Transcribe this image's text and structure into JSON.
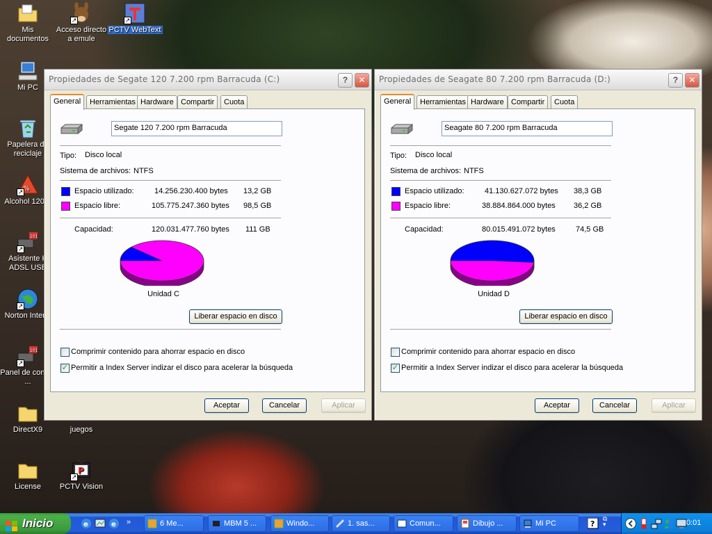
{
  "desktop": {
    "icons": [
      {
        "label": "Mis documentos"
      },
      {
        "label": "Acceso directo a emule"
      },
      {
        "label": "PCTV WebText"
      },
      {
        "label": "Mi PC"
      },
      {
        "label": "Papelera de reciclaje"
      },
      {
        "label": "Alcohol 120%"
      },
      {
        "label": "Asistente K ADSL USB"
      },
      {
        "label": "Norton Inter..."
      },
      {
        "label": "Panel de control ..."
      },
      {
        "label": "DirectX9"
      },
      {
        "label": "juegos"
      },
      {
        "label": "License"
      },
      {
        "label": "PCTV Vision"
      }
    ]
  },
  "dialogs": [
    {
      "title": "Propiedades de Segate 120 7.200 rpm Barracuda (C:)",
      "tabs": [
        "General",
        "Herramientas",
        "Hardware",
        "Compartir",
        "Cuota"
      ],
      "name": "Segate 120 7.200 rpm Barracuda",
      "tipo_label": "Tipo:",
      "tipo": "Disco local",
      "fs_label": "Sistema de archivos:",
      "fs": "NTFS",
      "used_label": "Espacio utilizado:",
      "used_bytes": "14.256.230.400 bytes",
      "used_gb": "13,2 GB",
      "free_label": "Espacio libre:",
      "free_bytes": "105.775.247.360 bytes",
      "free_gb": "98,5 GB",
      "cap_label": "Capacidad:",
      "cap_bytes": "120.031.477.760 bytes",
      "cap_gb": "111 GB",
      "used_fraction": 0.119,
      "drive_label": "Unidad C",
      "cleanup": "Liberar espacio en disco",
      "compress": "Comprimir contenido para ahorrar espacio en disco",
      "compress_checked": false,
      "index": "Permitir a Index Server indizar el disco para acelerar la búsqueda",
      "index_checked": true,
      "ok": "Aceptar",
      "cancel": "Cancelar",
      "apply": "Aplicar"
    },
    {
      "title": "Propiedades de Seagate 80 7.200 rpm Barracuda (D:)",
      "tabs": [
        "General",
        "Herramientas",
        "Hardware",
        "Compartir",
        "Cuota"
      ],
      "name": "Seagate 80 7.200 rpm Barracuda",
      "tipo_label": "Tipo:",
      "tipo": "Disco local",
      "fs_label": "Sistema de archivos:",
      "fs": "NTFS",
      "used_label": "Espacio utilizado:",
      "used_bytes": "41.130.627.072 bytes",
      "used_gb": "38,3 GB",
      "free_label": "Espacio libre:",
      "free_bytes": "38.884.864.000 bytes",
      "free_gb": "36,2 GB",
      "cap_label": "Capacidad:",
      "cap_bytes": "80.015.491.072 bytes",
      "cap_gb": "74,5 GB",
      "used_fraction": 0.514,
      "drive_label": "Unidad D",
      "cleanup": "Liberar espacio en disco",
      "compress": "Comprimir contenido para ahorrar espacio en disco",
      "compress_checked": false,
      "index": "Permitir a Index Server indizar el disco para acelerar la búsqueda",
      "index_checked": true,
      "ok": "Aceptar",
      "cancel": "Cancelar",
      "apply": "Aplicar"
    }
  ],
  "colors": {
    "used": "#0000ff",
    "free": "#ff00ff",
    "used_dark": "#00008b",
    "free_dark": "#8b008b"
  },
  "taskbar": {
    "start": "Inicio",
    "tasks": [
      {
        "label": "6 Me...",
        "icon": "puzzle-icon"
      },
      {
        "label": "MBM 5 ...",
        "icon": "chip-icon"
      },
      {
        "label": "Windo...",
        "icon": "puzzle-icon"
      },
      {
        "label": "1. sas...",
        "icon": "tools-icon"
      },
      {
        "label": "Comun...",
        "icon": "window-icon"
      },
      {
        "label": "Dibujo ...",
        "icon": "paint-icon"
      },
      {
        "label": "Mi PC",
        "icon": "computer-icon"
      }
    ],
    "clock": "0:01"
  }
}
